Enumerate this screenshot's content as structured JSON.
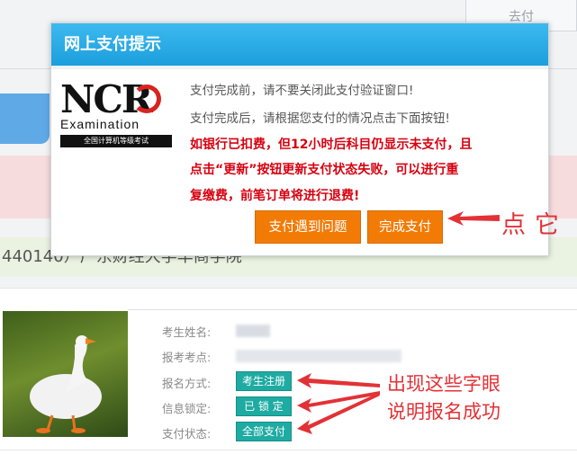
{
  "background": {
    "top_tab_label": "去付",
    "partial_text": "440140）广东财经大学华商学院"
  },
  "modal": {
    "title": "网上支付提示",
    "logo": {
      "main": "NCR",
      "sub": "Examination",
      "band": "全国计算机等级考试"
    },
    "messages": [
      "支付完成前，请不要关闭此支付验证窗口!",
      "支付完成后，请根据您支付的情况点击下面按钮!"
    ],
    "warnings": [
      "如银行已扣费，但12小时后科目仍显示未支付，且",
      "点击“更新”按钮更新支付状态失败，可以进行重",
      "复缴费，前笔订单将进行退费!"
    ],
    "buttons": {
      "problem": "支付遇到问题",
      "done": "完成支付"
    },
    "annotation": "点它"
  },
  "profile": {
    "labels": {
      "name": "考生姓名:",
      "site": "报考考点:",
      "mode": "报名方式:",
      "lock": "信息锁定:",
      "pay": "支付状态:"
    },
    "tags": {
      "mode": "考生注册",
      "lock": "已 锁 定",
      "pay": "全部支付"
    },
    "annotation": [
      "出现这些字眼",
      "说明报名成功"
    ]
  },
  "colors": {
    "header": "#1b9fdd",
    "orange_button": "#f27b06",
    "warning_red": "#d7000f",
    "teal_tag": "#1eaba2",
    "annotation_red": "#e23236"
  }
}
